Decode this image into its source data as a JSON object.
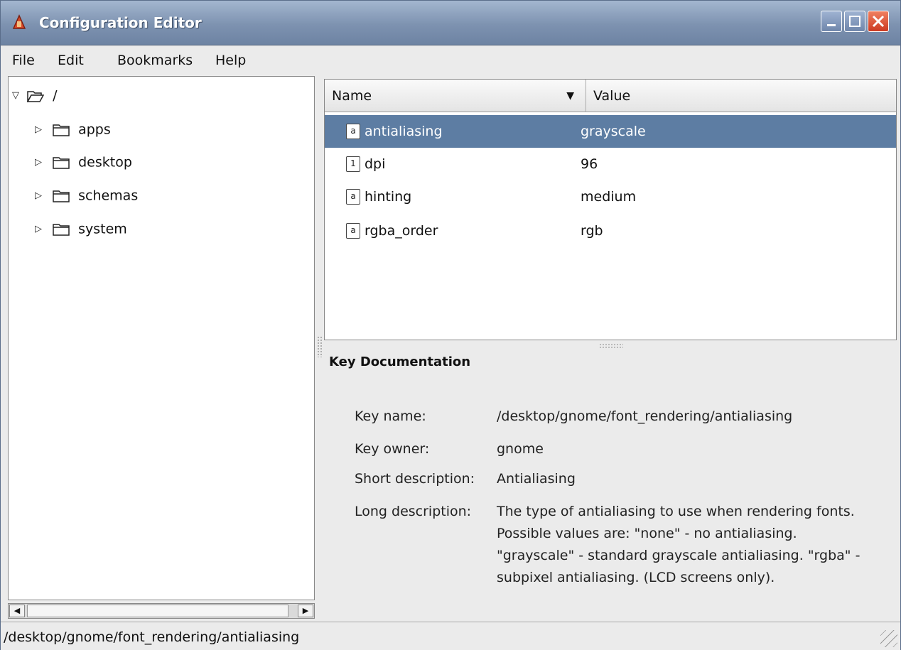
{
  "window": {
    "title": "Configuration Editor"
  },
  "menu": {
    "file": "File",
    "edit": "Edit",
    "bookmarks": "Bookmarks",
    "help": "Help"
  },
  "tree": {
    "root": "/",
    "items": [
      {
        "label": "apps"
      },
      {
        "label": "desktop"
      },
      {
        "label": "schemas"
      },
      {
        "label": "system"
      }
    ]
  },
  "keys": {
    "columns": {
      "name": "Name",
      "value": "Value"
    },
    "rows": [
      {
        "icon": "a",
        "name": "antialiasing",
        "value": "grayscale",
        "selected": true
      },
      {
        "icon": "1",
        "name": "dpi",
        "value": "96"
      },
      {
        "icon": "a",
        "name": "hinting",
        "value": "medium"
      },
      {
        "icon": "a",
        "name": "rgba_order",
        "value": "rgb"
      }
    ]
  },
  "doc": {
    "title": "Key Documentation",
    "key_name_label": "Key name:",
    "key_name": "/desktop/gnome/font_rendering/antialiasing",
    "key_owner_label": "Key owner:",
    "key_owner": "gnome",
    "short_label": "Short description:",
    "short": "Antialiasing",
    "long_label": "Long description:",
    "long": "The type of antialiasing to use when rendering fonts. Possible values are: \"none\" - no antialiasing. \"grayscale\" - standard grayscale antialiasing. \"rgba\" - subpixel antialiasing. (LCD screens only)."
  },
  "status": {
    "path": "/desktop/gnome/font_rendering/antialiasing"
  },
  "icons": {
    "app": "configuration-editor-icon",
    "minimize": "minimize-icon",
    "maximize": "maximize-icon",
    "close": "close-icon",
    "folder": "folder-icon",
    "string_key": "string-key-icon",
    "int_key": "integer-key-icon"
  },
  "colors": {
    "titlebar": "#7d92b0",
    "selection": "#5d7da3",
    "close": "#cc3a22"
  }
}
